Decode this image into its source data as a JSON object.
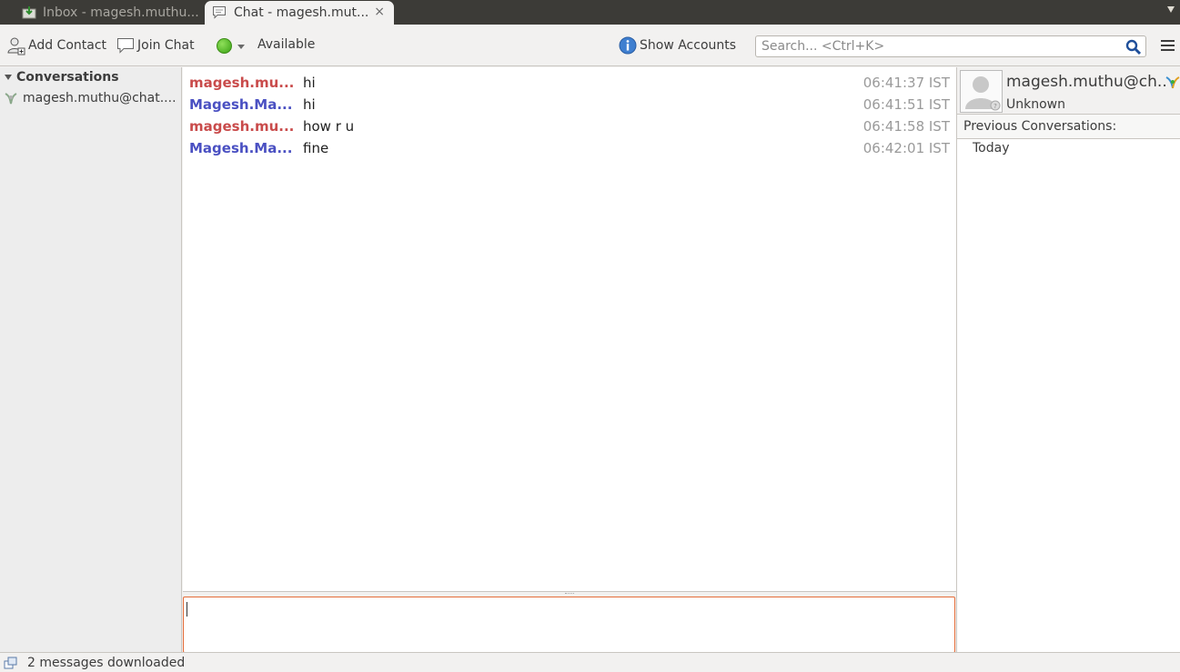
{
  "tabs": [
    {
      "label": "Inbox - magesh.muthu...",
      "icon": "mail-inbox-icon",
      "active": false
    },
    {
      "label": "Chat - magesh.mut...",
      "icon": "chat-bubble-icon",
      "active": true,
      "close_glyph": "×"
    }
  ],
  "toolbar": {
    "add_contact": "Add Contact",
    "join_chat": "Join Chat",
    "status": "Available",
    "status_color": "#4cbc1f",
    "show_accounts": "Show Accounts",
    "search_placeholder": "Search... <Ctrl+K>"
  },
  "sidebar": {
    "section_title": "Conversations",
    "items": [
      {
        "label": "magesh.muthu@chat....",
        "icon": "buddy-protocol-icon"
      }
    ]
  },
  "chat": {
    "messages": [
      {
        "nick": "magesh.mu...",
        "text": "hi",
        "time": "06:41:37 IST",
        "color": "#c94b4b"
      },
      {
        "nick": "Magesh.Ma...",
        "text": "hi",
        "time": "06:41:51 IST",
        "color": "#4a50c2"
      },
      {
        "nick": "magesh.mu...",
        "text": "how r u",
        "time": "06:41:58 IST",
        "color": "#c94b4b"
      },
      {
        "nick": "Magesh.Ma...",
        "text": "fine",
        "time": "06:42:01 IST",
        "color": "#4a50c2"
      }
    ],
    "input_value": ""
  },
  "contact_panel": {
    "name": "magesh.muthu@ch...",
    "status": "Unknown",
    "previous_conversations_label": "Previous Conversations:",
    "previous_conversations": [
      "Today"
    ]
  },
  "statusbar": {
    "text": "2 messages downloaded"
  },
  "colors": {
    "accent_input_border": "#e46c38",
    "tabbar_bg": "#3c3b37"
  }
}
